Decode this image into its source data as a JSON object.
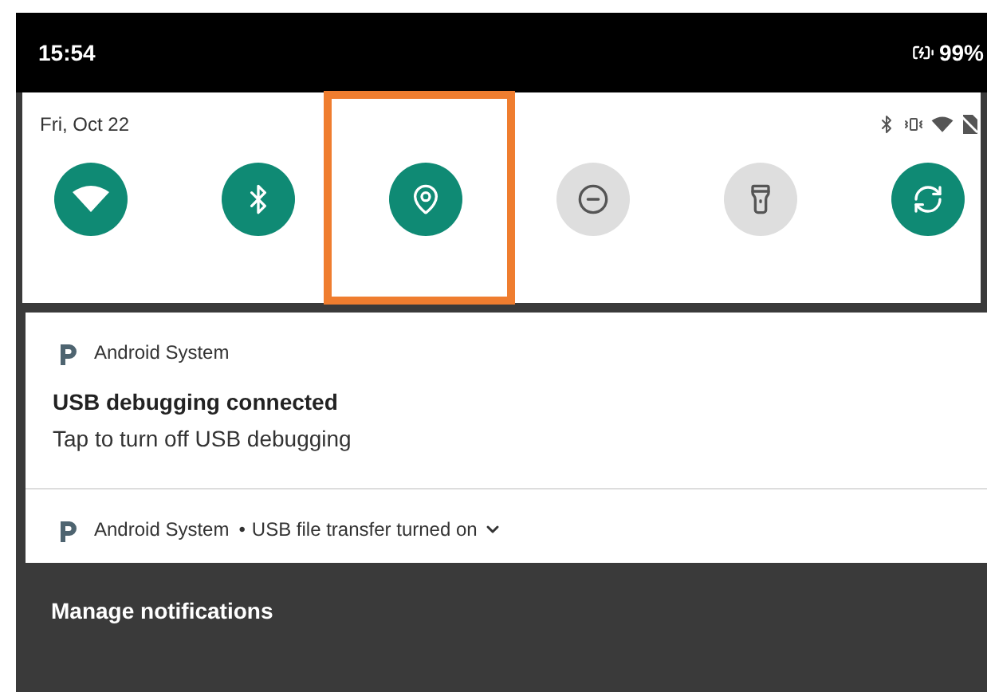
{
  "status_bar": {
    "time": "15:54",
    "battery": "99%"
  },
  "quick_settings": {
    "date": "Fri, Oct 22",
    "tiles": [
      {
        "kind": "wifi",
        "on": true,
        "highlighted": false
      },
      {
        "kind": "bluetooth",
        "on": true,
        "highlighted": false
      },
      {
        "kind": "location",
        "on": true,
        "highlighted": true
      },
      {
        "kind": "dnd",
        "on": false,
        "highlighted": false
      },
      {
        "kind": "flashlight",
        "on": false,
        "highlighted": false
      },
      {
        "kind": "rotate",
        "on": true,
        "highlighted": false
      }
    ]
  },
  "notifications": [
    {
      "app": "Android System",
      "title": "USB debugging connected",
      "text": "Tap to turn off USB debugging"
    },
    {
      "app": "Android System",
      "separator": "•",
      "summary": "USB file transfer turned on"
    }
  ],
  "footer": {
    "manage": "Manage notifications"
  }
}
